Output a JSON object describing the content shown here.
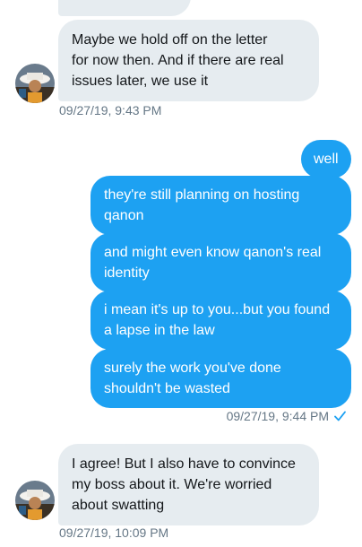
{
  "conversation": {
    "messages": [
      {
        "direction": "in",
        "text": "Maybe we hold off on the letter\nfor now then. And if there are real\nissues later, we use it"
      },
      {
        "direction": "out",
        "text": "well"
      },
      {
        "direction": "out",
        "text": "they're still planning on hosting\nqanon"
      },
      {
        "direction": "out",
        "text": "and might even know qanon's real\nidentity"
      },
      {
        "direction": "out",
        "text": "i mean it's up to you...but you found\na lapse in the law"
      },
      {
        "direction": "out",
        "text": "surely the work you've done\nshouldn't be wasted"
      },
      {
        "direction": "in",
        "text": "I agree! But I also have to convince\nmy boss about it. We're worried\nabout swatting"
      }
    ],
    "timestamps": {
      "first": "09/27/19, 9:43 PM",
      "sent": "09/27/19, 9:44 PM",
      "last": "09/27/19, 10:09 PM"
    }
  },
  "colors": {
    "outgoing_bubble": "#1da1f2",
    "incoming_bubble": "#e6ecf0",
    "timestamp": "#657786",
    "read_check": "#1da1f2"
  },
  "icons": {
    "avatar": "avatar",
    "read_receipt": "check-icon"
  }
}
